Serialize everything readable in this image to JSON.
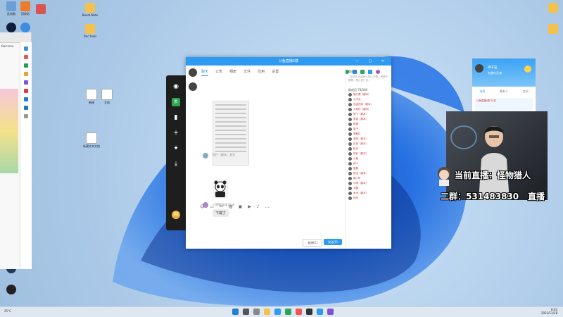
{
  "desktop": {
    "icons_left": [
      {
        "label": "此电脑"
      },
      {
        "label": "回收站"
      },
      {
        "label": ""
      },
      {
        "label": ""
      }
    ],
    "icons_top": [
      {
        "label": "Boom.Note"
      },
      {
        "label": "Doc.tools"
      }
    ],
    "icons_mid": [
      {
        "label": "新建"
      },
      {
        "label": "文档"
      },
      {
        "label": "新建文本文档"
      }
    ],
    "icons_right": [
      {
        "label": ""
      },
      {
        "label": ""
      }
    ]
  },
  "browser": {
    "address": "Baicome"
  },
  "chat_window": {
    "title": "斗鱼直播5群",
    "tabs": [
      "聊天",
      "公告",
      "相册",
      "文件",
      "应用",
      "设置"
    ],
    "active_tab": "聊天",
    "message_sender": "用户（副本）发言",
    "message_sender2": "小黑猫(副本)发送",
    "bubble_text": "下载了",
    "btn_close": "关闭(C)",
    "btn_send": "发送(S)"
  },
  "group_panel": {
    "notice_title": "群通知",
    "notice_body": "【公告】欢迎新人加入本群，请遵守群规，禁止发广告。",
    "members_title": "群成员 78/500",
    "members": [
      "猫头鹰（副本）",
      "小不点",
      "自由的风（副本）",
      "大家好（副本）",
      "阿飞（副本）",
      "勇者（副本）",
      "阿狸",
      "影子",
      "哥斯拉",
      "清风（副本）",
      "白白（副本）",
      "拾光",
      "风铃（副本）",
      "小鱼",
      "伊人",
      "星星",
      "夜空（副本）",
      "路人甲",
      "小明（副本）",
      "大鹏",
      "木木（副本）",
      "阿杰"
    ]
  },
  "qq_main": {
    "name": "神子猫",
    "signature": "有趣的灵魂",
    "tabs": [
      "消息",
      "联系人",
      "空间"
    ],
    "item1": "斗鱼直播5群 已发",
    "item2": ""
  },
  "overlay": {
    "live_label": "当前直播：怪物猎人",
    "group_label": "二群：531483830",
    "live_word": "直播"
  },
  "taskbar": {
    "weather": "25°C",
    "time": "8:02",
    "date": "2022/11/28"
  },
  "colors": {
    "accent": "#2f9af2",
    "overlay_text": "#ffffff"
  }
}
